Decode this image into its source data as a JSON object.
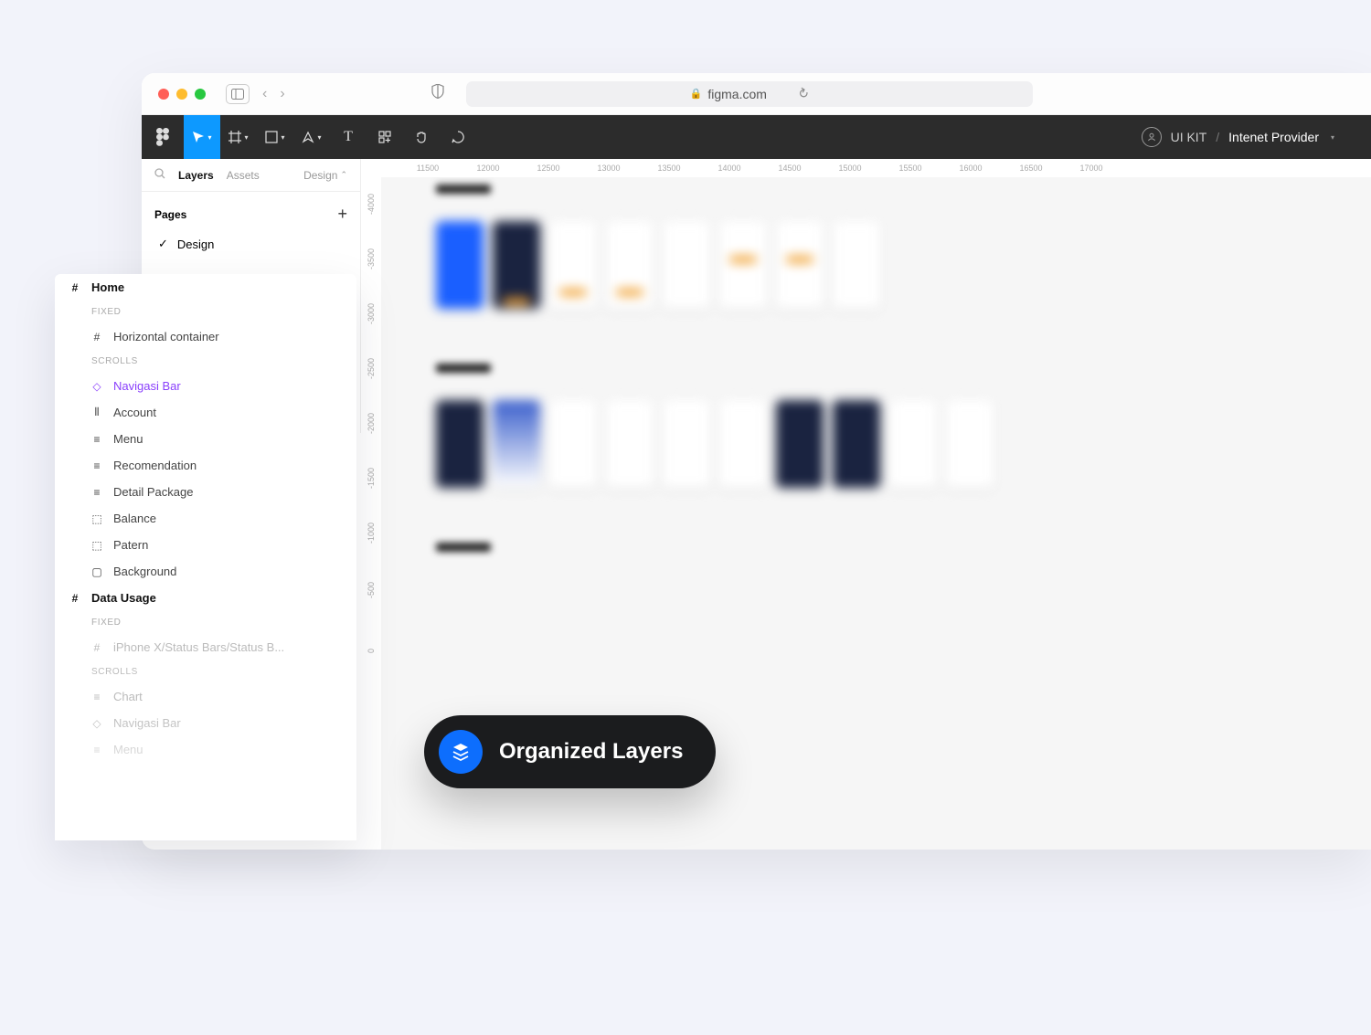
{
  "browser": {
    "url": "figma.com"
  },
  "figma": {
    "team": "UI KIT",
    "project": "Intenet Provider",
    "panel": {
      "tab_layers": "Layers",
      "tab_assets": "Assets",
      "tab_design": "Design",
      "pages_label": "Pages",
      "page_name": "Design"
    },
    "ruler_h": [
      "11500",
      "12000",
      "12500",
      "13000",
      "13500",
      "14000",
      "14500",
      "15000",
      "15500",
      "16000",
      "16500",
      "17000"
    ],
    "ruler_v": [
      "-4000",
      "-3500",
      "-3000",
      "-2500",
      "-2000",
      "-1500",
      "-1000",
      "-500",
      "0"
    ]
  },
  "layers": {
    "items": [
      {
        "icon": "#",
        "label": "Home",
        "indent": 0,
        "style": "bold"
      },
      {
        "label": "FIXED",
        "section": true
      },
      {
        "icon": "#",
        "label": "Horizontal container",
        "indent": 1
      },
      {
        "label": "SCROLLS",
        "section": true
      },
      {
        "icon": "◇",
        "label": "Navigasi Bar",
        "indent": 1,
        "style": "purple"
      },
      {
        "icon": "⦀",
        "label": "Account",
        "indent": 1
      },
      {
        "icon": "≡",
        "label": "Menu",
        "indent": 1
      },
      {
        "icon": "≡",
        "label": "Recomendation",
        "indent": 1
      },
      {
        "icon": "≡",
        "label": "Detail Package",
        "indent": 1
      },
      {
        "icon": "⬚",
        "label": "Balance",
        "indent": 1
      },
      {
        "icon": "⬚",
        "label": "Patern",
        "indent": 1
      },
      {
        "icon": "▢",
        "label": "Background",
        "indent": 1
      },
      {
        "icon": "#",
        "label": "Data Usage",
        "indent": 0,
        "style": "bold"
      },
      {
        "label": "FIXED",
        "section": true
      },
      {
        "icon": "#",
        "label": "iPhone X/Status Bars/Status B...",
        "indent": 1,
        "style": "faded"
      },
      {
        "label": "SCROLLS",
        "section": true,
        "style": "faded"
      },
      {
        "icon": "≡",
        "label": "Chart",
        "indent": 1,
        "style": "faded"
      },
      {
        "icon": "◇",
        "label": "Navigasi Bar",
        "indent": 1,
        "style": "faded"
      },
      {
        "icon": "≡",
        "label": "Menu",
        "indent": 1,
        "style": "faded"
      }
    ]
  },
  "badge": {
    "label": "Organized Layers"
  }
}
